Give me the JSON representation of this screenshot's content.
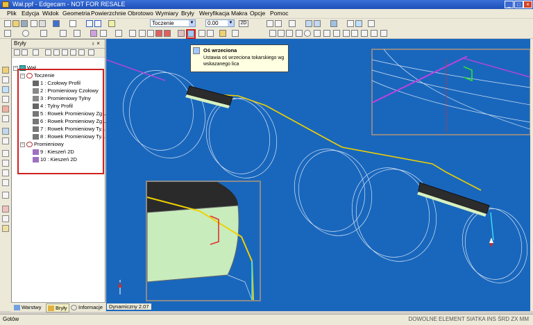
{
  "window": {
    "title": "Wał.ppf - Edgecam - NOT FOR RESALE",
    "minimize": "_",
    "maximize": "□",
    "close": "×"
  },
  "menu": [
    "Plik",
    "Edycja",
    "Widok",
    "Geometria",
    "Powierzchnie",
    "Obrotowo",
    "Wymiary",
    "Bryły",
    "Weryfikacja",
    "Makra",
    "Opcje",
    "Pomoc"
  ],
  "toolbar": {
    "mode_combo": "Toczenie",
    "value_combo": "0.00",
    "mode_2d": "2D"
  },
  "panel": {
    "title": "Bryły",
    "pin": "♁ ×",
    "root": "Wał",
    "groups": [
      {
        "label": "Toczenie",
        "items": [
          "1 : Czołowy Profil",
          "2 : Promieniowy Czołowy",
          "3 : Promieniowy Tylny",
          "4 : Tylny Profil",
          "5 : Rowek Promieniowy Zg...",
          "6 : Rowek Promieniowy Zg...",
          "7 : Rowek Promieniowy Ty...",
          "8 : Rowek Promieniowy Ty..."
        ]
      },
      {
        "label": "Promieniowy",
        "items": [
          "9 : Kieszeń 2D",
          "10 : Kieszeń 2D"
        ]
      }
    ],
    "tabs": [
      "Warstwy",
      "Bryły",
      "Informacje"
    ]
  },
  "tooltip": {
    "title": "Oś wrzeciona",
    "description": "Ustawia oś wrzeciona tokarskiego wg wskazanego lica"
  },
  "viewport": {
    "status_label": "Dynamiczny 2.07",
    "background": "#1967bd"
  },
  "status": {
    "left": "Gotów",
    "right": "DOWOLNE  ELEMENT  SIATKA  INS  ŚRD  ZX  MM"
  },
  "colors": {
    "highlight": "#d0201e",
    "toolpath_yellow": "#f0d000",
    "toolpath_magenta": "#c040e0",
    "toolpath_cyan": "#40e0f0",
    "toolpath_green": "#30e030"
  }
}
